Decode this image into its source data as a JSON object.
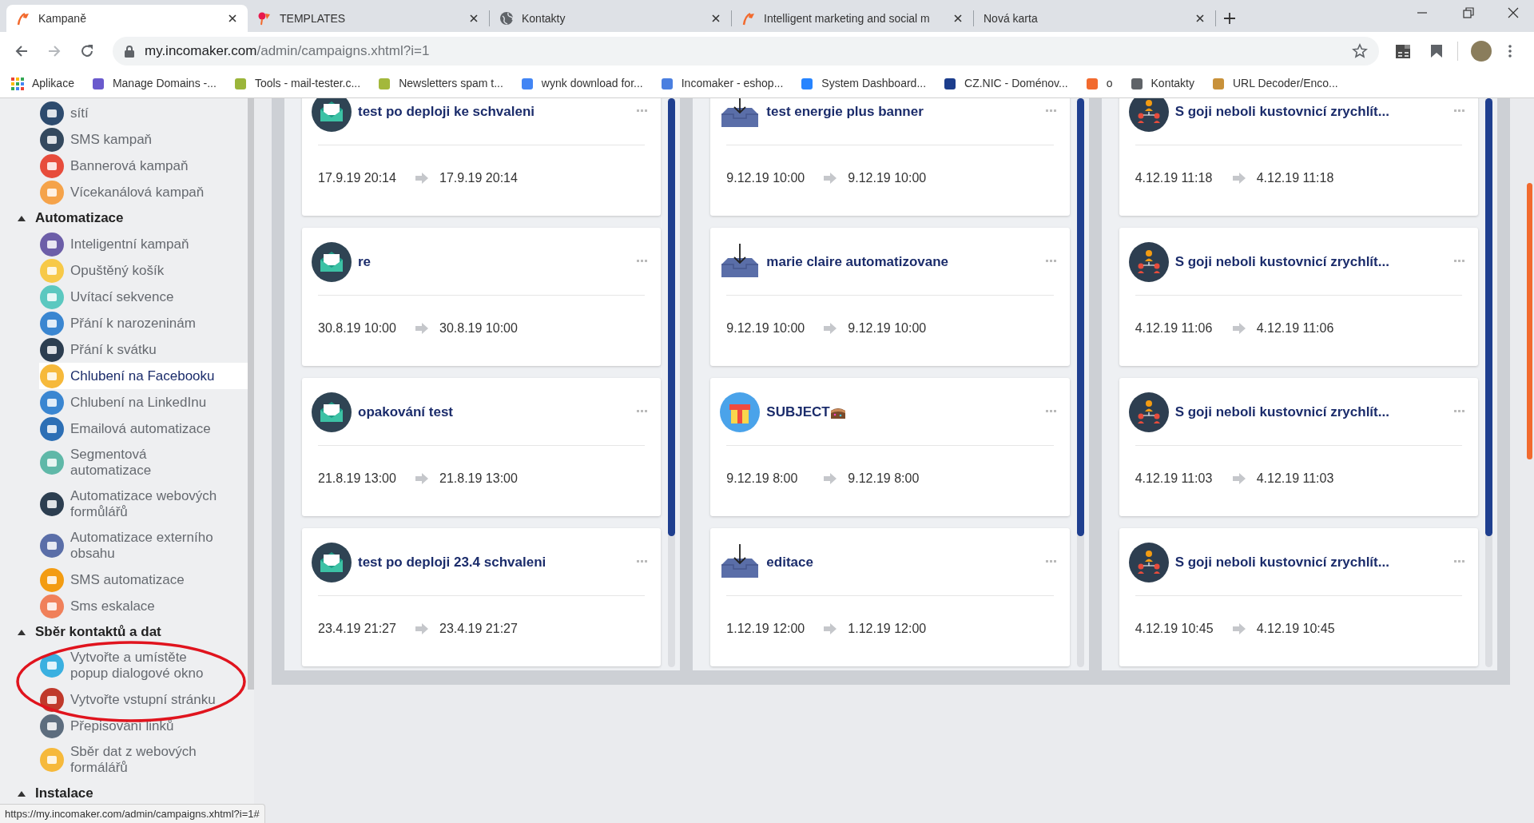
{
  "browser": {
    "tabs": [
      {
        "title": "Kampaně",
        "kind": "incomaker",
        "selected": true
      },
      {
        "title": "TEMPLATES",
        "kind": "templates",
        "selected": false
      },
      {
        "title": "Kontakty",
        "kind": "globe",
        "selected": false
      },
      {
        "title": "Intelligent marketing and social m",
        "kind": "incomaker",
        "selected": false
      },
      {
        "title": "Nová karta",
        "kind": "blank",
        "selected": false
      }
    ],
    "address": {
      "host": "my.incomaker.com",
      "path": "/admin/campaigns.xhtml?i=1"
    },
    "bookmarks": [
      {
        "label": "Aplikace",
        "kind": "apps"
      },
      {
        "label": "Manage Domains -...",
        "kind": "site",
        "color": "#6a5acd"
      },
      {
        "label": "Tools - mail-tester.c...",
        "kind": "site",
        "color": "#9bb53a"
      },
      {
        "label": "Newsletters spam t...",
        "kind": "site",
        "color": "#a3b83c"
      },
      {
        "label": "wynk download for...",
        "kind": "site",
        "color": "#4285f4"
      },
      {
        "label": "Incomaker - eshop...",
        "kind": "site",
        "color": "#4a7fe0"
      },
      {
        "label": "System Dashboard...",
        "kind": "site",
        "color": "#2684ff"
      },
      {
        "label": "CZ.NIC - Doménov...",
        "kind": "site",
        "color": "#1c3d8c"
      },
      {
        "label": "o",
        "kind": "site",
        "color": "#f26a2e"
      },
      {
        "label": "Kontakty",
        "kind": "site",
        "color": "#5f6368"
      },
      {
        "label": "URL Decoder/Enco...",
        "kind": "site",
        "color": "#c8913a"
      }
    ]
  },
  "sidebar": {
    "groups": [
      {
        "items": [
          {
            "label": "sítí",
            "color": "#2d4b6e",
            "selected": false
          },
          {
            "label": "SMS kampaň",
            "color": "#34495e",
            "selected": false
          },
          {
            "label": "Bannerová kampaň",
            "color": "#e74c3c",
            "selected": false
          },
          {
            "label": "Vícekanálová kampaň",
            "color": "#f5a34a",
            "selected": false
          }
        ]
      },
      {
        "title": "Automatizace",
        "expanded": true,
        "items": [
          {
            "label": "Inteligentní kampaň",
            "color": "#6c5ea8",
            "selected": false
          },
          {
            "label": "Opuštěný košík",
            "color": "#f7c948",
            "selected": false
          },
          {
            "label": "Uvítací sekvence",
            "color": "#5bc8c0",
            "selected": false
          },
          {
            "label": "Přání k narozeninám",
            "color": "#3a86d1",
            "selected": false
          },
          {
            "label": "Přání k svátku",
            "color": "#2c3e50",
            "selected": false
          },
          {
            "label": "Chlubení na Facebooku",
            "color": "#f6b93b",
            "selected": true
          },
          {
            "label": "Chlubení na LinkedInu",
            "color": "#3a86d1",
            "selected": false
          },
          {
            "label": "Emailová automatizace",
            "color": "#2d6fb5",
            "selected": false
          },
          {
            "label": "Segmentová automatizace",
            "color": "#5fb8a8",
            "selected": false
          },
          {
            "label": "Automatizace webových formůlářů",
            "color": "#2c3e50",
            "selected": false
          },
          {
            "label": "Automatizace externího obsahu",
            "color": "#5a6ea8",
            "selected": false
          },
          {
            "label": "SMS automatizace",
            "color": "#f39c12",
            "selected": false
          },
          {
            "label": "Sms eskalace",
            "color": "#f0805a",
            "selected": false
          }
        ]
      },
      {
        "title": "Sběr kontaktů a dat",
        "expanded": true,
        "items": [
          {
            "label": "Vytvořte a umístěte popup dialogové okno",
            "color": "#3ab0e0",
            "selected": false
          },
          {
            "label": "Vytvořte vstupní stránku",
            "color": "#c0392b",
            "selected": false
          },
          {
            "label": "Přepisování linků",
            "color": "#5d6d7e",
            "selected": false
          },
          {
            "label": "Sběr dat z webových formálářů",
            "color": "#f6b93b",
            "selected": false
          }
        ]
      },
      {
        "title": "Instalace",
        "expanded": true
      }
    ]
  },
  "columns": [
    {
      "cards": [
        {
          "kind": "email",
          "title": "test po deploji ke schvaleni",
          "start": "17.9.19 20:14",
          "end": "17.9.19 20:14"
        },
        {
          "kind": "email",
          "title": "re",
          "start": "30.8.19 10:00",
          "end": "30.8.19 10:00"
        },
        {
          "kind": "email",
          "title": "opakování test",
          "start": "21.8.19 13:00",
          "end": "21.8.19 13:00"
        },
        {
          "kind": "email",
          "title": "test po deploji 23.4 schvaleni",
          "start": "23.4.19 21:27",
          "end": "23.4.19 21:27"
        }
      ]
    },
    {
      "cards": [
        {
          "kind": "inbox",
          "title": "test energie plus banner",
          "start": "9.12.19 10:00",
          "end": "9.12.19 10:00"
        },
        {
          "kind": "inbox",
          "title": "marie claire automatizovane",
          "start": "9.12.19 10:00",
          "end": "9.12.19 10:00"
        },
        {
          "kind": "gift",
          "title": "SUBJECT",
          "cake": true,
          "start": "9.12.19 8:00",
          "end": "9.12.19 8:00"
        },
        {
          "kind": "inbox",
          "title": "editace",
          "start": "1.12.19 12:00",
          "end": "1.12.19 12:00"
        }
      ]
    },
    {
      "cards": [
        {
          "kind": "people",
          "title": "S goji neboli kustovnicí zrychlít...",
          "start": "4.12.19 11:18",
          "end": "4.12.19 11:18"
        },
        {
          "kind": "people",
          "title": "S goji neboli kustovnicí zrychlít...",
          "start": "4.12.19 11:06",
          "end": "4.12.19 11:06"
        },
        {
          "kind": "people",
          "title": "S goji neboli kustovnicí zrychlít...",
          "start": "4.12.19 11:03",
          "end": "4.12.19 11:03"
        },
        {
          "kind": "people",
          "title": "S goji neboli kustovnicí zrychlít...",
          "start": "4.12.19 10:45",
          "end": "4.12.19 10:45"
        }
      ]
    }
  ],
  "status_url": "https://my.incomaker.com/admin/campaigns.xhtml?i=1#"
}
